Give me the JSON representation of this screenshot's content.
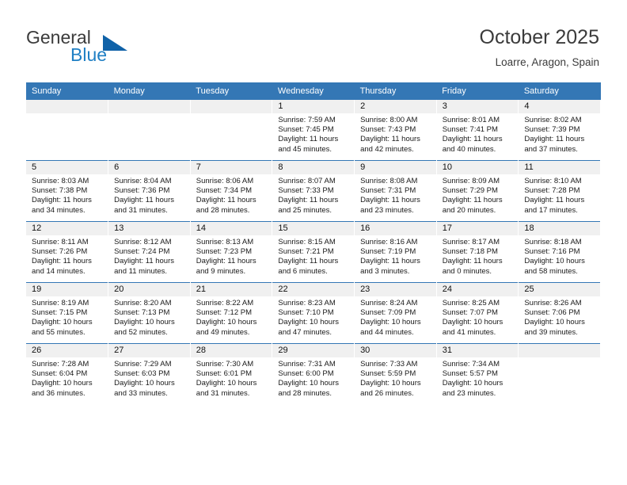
{
  "brand": {
    "word1": "General",
    "word2": "Blue",
    "triangle_color": "#1062a8",
    "blue_color": "#1f7fc4"
  },
  "header": {
    "title": "October 2025",
    "subtitle": "Loarre, Aragon, Spain"
  },
  "theme": {
    "header_bg": "#3477b5",
    "date_strip_bg": "#f0f0f0",
    "week_divider": "#3477b5"
  },
  "weekday_headers": [
    "Sunday",
    "Monday",
    "Tuesday",
    "Wednesday",
    "Thursday",
    "Friday",
    "Saturday"
  ],
  "weeks": [
    [
      {
        "date": "",
        "empty": true,
        "sunrise": "",
        "sunset": "",
        "daylight1": "",
        "daylight2": ""
      },
      {
        "date": "",
        "empty": true,
        "sunrise": "",
        "sunset": "",
        "daylight1": "",
        "daylight2": ""
      },
      {
        "date": "",
        "empty": true,
        "sunrise": "",
        "sunset": "",
        "daylight1": "",
        "daylight2": ""
      },
      {
        "date": "1",
        "sunrise": "Sunrise: 7:59 AM",
        "sunset": "Sunset: 7:45 PM",
        "daylight1": "Daylight: 11 hours",
        "daylight2": "and 45 minutes."
      },
      {
        "date": "2",
        "sunrise": "Sunrise: 8:00 AM",
        "sunset": "Sunset: 7:43 PM",
        "daylight1": "Daylight: 11 hours",
        "daylight2": "and 42 minutes."
      },
      {
        "date": "3",
        "sunrise": "Sunrise: 8:01 AM",
        "sunset": "Sunset: 7:41 PM",
        "daylight1": "Daylight: 11 hours",
        "daylight2": "and 40 minutes."
      },
      {
        "date": "4",
        "sunrise": "Sunrise: 8:02 AM",
        "sunset": "Sunset: 7:39 PM",
        "daylight1": "Daylight: 11 hours",
        "daylight2": "and 37 minutes."
      }
    ],
    [
      {
        "date": "5",
        "sunrise": "Sunrise: 8:03 AM",
        "sunset": "Sunset: 7:38 PM",
        "daylight1": "Daylight: 11 hours",
        "daylight2": "and 34 minutes."
      },
      {
        "date": "6",
        "sunrise": "Sunrise: 8:04 AM",
        "sunset": "Sunset: 7:36 PM",
        "daylight1": "Daylight: 11 hours",
        "daylight2": "and 31 minutes."
      },
      {
        "date": "7",
        "sunrise": "Sunrise: 8:06 AM",
        "sunset": "Sunset: 7:34 PM",
        "daylight1": "Daylight: 11 hours",
        "daylight2": "and 28 minutes."
      },
      {
        "date": "8",
        "sunrise": "Sunrise: 8:07 AM",
        "sunset": "Sunset: 7:33 PM",
        "daylight1": "Daylight: 11 hours",
        "daylight2": "and 25 minutes."
      },
      {
        "date": "9",
        "sunrise": "Sunrise: 8:08 AM",
        "sunset": "Sunset: 7:31 PM",
        "daylight1": "Daylight: 11 hours",
        "daylight2": "and 23 minutes."
      },
      {
        "date": "10",
        "sunrise": "Sunrise: 8:09 AM",
        "sunset": "Sunset: 7:29 PM",
        "daylight1": "Daylight: 11 hours",
        "daylight2": "and 20 minutes."
      },
      {
        "date": "11",
        "sunrise": "Sunrise: 8:10 AM",
        "sunset": "Sunset: 7:28 PM",
        "daylight1": "Daylight: 11 hours",
        "daylight2": "and 17 minutes."
      }
    ],
    [
      {
        "date": "12",
        "sunrise": "Sunrise: 8:11 AM",
        "sunset": "Sunset: 7:26 PM",
        "daylight1": "Daylight: 11 hours",
        "daylight2": "and 14 minutes."
      },
      {
        "date": "13",
        "sunrise": "Sunrise: 8:12 AM",
        "sunset": "Sunset: 7:24 PM",
        "daylight1": "Daylight: 11 hours",
        "daylight2": "and 11 minutes."
      },
      {
        "date": "14",
        "sunrise": "Sunrise: 8:13 AM",
        "sunset": "Sunset: 7:23 PM",
        "daylight1": "Daylight: 11 hours",
        "daylight2": "and 9 minutes."
      },
      {
        "date": "15",
        "sunrise": "Sunrise: 8:15 AM",
        "sunset": "Sunset: 7:21 PM",
        "daylight1": "Daylight: 11 hours",
        "daylight2": "and 6 minutes."
      },
      {
        "date": "16",
        "sunrise": "Sunrise: 8:16 AM",
        "sunset": "Sunset: 7:19 PM",
        "daylight1": "Daylight: 11 hours",
        "daylight2": "and 3 minutes."
      },
      {
        "date": "17",
        "sunrise": "Sunrise: 8:17 AM",
        "sunset": "Sunset: 7:18 PM",
        "daylight1": "Daylight: 11 hours",
        "daylight2": "and 0 minutes."
      },
      {
        "date": "18",
        "sunrise": "Sunrise: 8:18 AM",
        "sunset": "Sunset: 7:16 PM",
        "daylight1": "Daylight: 10 hours",
        "daylight2": "and 58 minutes."
      }
    ],
    [
      {
        "date": "19",
        "sunrise": "Sunrise: 8:19 AM",
        "sunset": "Sunset: 7:15 PM",
        "daylight1": "Daylight: 10 hours",
        "daylight2": "and 55 minutes."
      },
      {
        "date": "20",
        "sunrise": "Sunrise: 8:20 AM",
        "sunset": "Sunset: 7:13 PM",
        "daylight1": "Daylight: 10 hours",
        "daylight2": "and 52 minutes."
      },
      {
        "date": "21",
        "sunrise": "Sunrise: 8:22 AM",
        "sunset": "Sunset: 7:12 PM",
        "daylight1": "Daylight: 10 hours",
        "daylight2": "and 49 minutes."
      },
      {
        "date": "22",
        "sunrise": "Sunrise: 8:23 AM",
        "sunset": "Sunset: 7:10 PM",
        "daylight1": "Daylight: 10 hours",
        "daylight2": "and 47 minutes."
      },
      {
        "date": "23",
        "sunrise": "Sunrise: 8:24 AM",
        "sunset": "Sunset: 7:09 PM",
        "daylight1": "Daylight: 10 hours",
        "daylight2": "and 44 minutes."
      },
      {
        "date": "24",
        "sunrise": "Sunrise: 8:25 AM",
        "sunset": "Sunset: 7:07 PM",
        "daylight1": "Daylight: 10 hours",
        "daylight2": "and 41 minutes."
      },
      {
        "date": "25",
        "sunrise": "Sunrise: 8:26 AM",
        "sunset": "Sunset: 7:06 PM",
        "daylight1": "Daylight: 10 hours",
        "daylight2": "and 39 minutes."
      }
    ],
    [
      {
        "date": "26",
        "sunrise": "Sunrise: 7:28 AM",
        "sunset": "Sunset: 6:04 PM",
        "daylight1": "Daylight: 10 hours",
        "daylight2": "and 36 minutes."
      },
      {
        "date": "27",
        "sunrise": "Sunrise: 7:29 AM",
        "sunset": "Sunset: 6:03 PM",
        "daylight1": "Daylight: 10 hours",
        "daylight2": "and 33 minutes."
      },
      {
        "date": "28",
        "sunrise": "Sunrise: 7:30 AM",
        "sunset": "Sunset: 6:01 PM",
        "daylight1": "Daylight: 10 hours",
        "daylight2": "and 31 minutes."
      },
      {
        "date": "29",
        "sunrise": "Sunrise: 7:31 AM",
        "sunset": "Sunset: 6:00 PM",
        "daylight1": "Daylight: 10 hours",
        "daylight2": "and 28 minutes."
      },
      {
        "date": "30",
        "sunrise": "Sunrise: 7:33 AM",
        "sunset": "Sunset: 5:59 PM",
        "daylight1": "Daylight: 10 hours",
        "daylight2": "and 26 minutes."
      },
      {
        "date": "31",
        "sunrise": "Sunrise: 7:34 AM",
        "sunset": "Sunset: 5:57 PM",
        "daylight1": "Daylight: 10 hours",
        "daylight2": "and 23 minutes."
      },
      {
        "date": "",
        "empty": true,
        "sunrise": "",
        "sunset": "",
        "daylight1": "",
        "daylight2": ""
      }
    ]
  ]
}
